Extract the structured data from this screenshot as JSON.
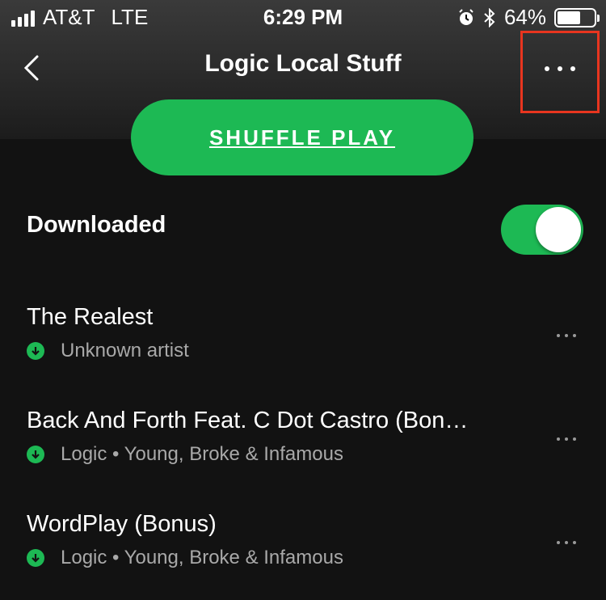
{
  "status_bar": {
    "carrier": "AT&T",
    "network": "LTE",
    "time": "6:29 PM",
    "battery_percent": "64%",
    "battery_level": 0.64
  },
  "nav": {
    "title": "Logic Local Stuff",
    "back_icon": "chevron-left-icon",
    "more_icon": "more-horizontal-icon"
  },
  "shuffle_button": {
    "label": "SHUFFLE PLAY"
  },
  "downloaded": {
    "label": "Downloaded",
    "enabled": true
  },
  "tracks": [
    {
      "title": "The Realest",
      "subtitle": "Unknown artist"
    },
    {
      "title": "Back And Forth Feat. C Dot Castro (Bon…",
      "subtitle": "Logic • Young, Broke & Infamous"
    },
    {
      "title": "WordPlay (Bonus)",
      "subtitle": "Logic • Young, Broke & Infamous"
    }
  ],
  "colors": {
    "accent": "#1db954",
    "highlight": "#e8351f",
    "background": "#121212"
  }
}
